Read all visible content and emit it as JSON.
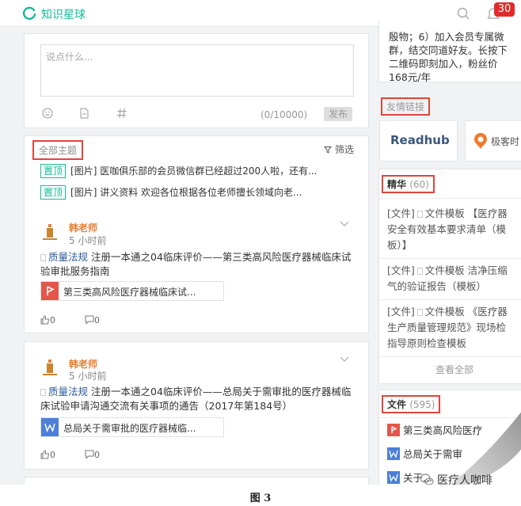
{
  "header": {
    "app_name": "知识星球",
    "notification_count": "30"
  },
  "compose": {
    "placeholder": "说点什么...",
    "char_count": "(0/10000)",
    "publish_label": "发布"
  },
  "topics": {
    "tab_label": "全部主题",
    "filter_label": "筛选",
    "pinned": [
      {
        "badge": "置顶",
        "text": "[图片] 医咖俱乐部的会员微信群已经超过200人啦，还有..."
      },
      {
        "badge": "置顶",
        "text": "[图片] 讲义资料 欢迎各位根据各位老师擅长领域向老..."
      }
    ],
    "posts": [
      {
        "author": "韩老师",
        "time": "5 小时前",
        "tag": "质量法规",
        "body": "注册一本通之04临床评价——第三类高风险医疗器械临床试验审批服务指南",
        "attachment": "第三类高风险医疗器械临床试...",
        "likes": "0",
        "comments": "0"
      },
      {
        "author": "韩老师",
        "time": "5 小时前",
        "tag": "质量法规",
        "body": "注册一本通之04临床评价——总局关于需审批的医疗器械临床试验申请沟通交流有关事项的通告（2017年第184号）",
        "attachment": "总局关于需审批的医疗器械临...",
        "likes": "0",
        "comments": "0"
      }
    ]
  },
  "sidebar": {
    "info_lines": [
      "殷物；6）加入会员专属微",
      "群，结交同道好友。长按下",
      "二维码即刻加入，粉丝价",
      "168元/年"
    ],
    "friend_links_title": "友情链接",
    "friend_links": [
      "Readhub",
      "极客时"
    ],
    "jinghua": {
      "title": "精华",
      "count": "(60)",
      "items": [
        [
          "[文件]",
          "文件模板 【医疗器",
          "安全有效基本要求清单（模",
          "板）】"
        ],
        [
          "[文件]",
          "文件模板 洁净压缩",
          "气的验证报告（模板）"
        ],
        [
          "[文件]",
          "文件模板 《医疗器",
          "生产质量管理规范》现场检",
          "指导原则检查模板"
        ]
      ],
      "see_all": "查看全部"
    },
    "files": {
      "title": "文件",
      "count": "(595)",
      "items": [
        "第三类高风险医疗",
        "总局关于需审",
        "关于..."
      ]
    }
  },
  "watermark": "医疗人咖啡",
  "caption": "图 3",
  "colors": {
    "accent": "#16b998",
    "highlight": "#e0453c",
    "badge": "#e02b2b"
  }
}
